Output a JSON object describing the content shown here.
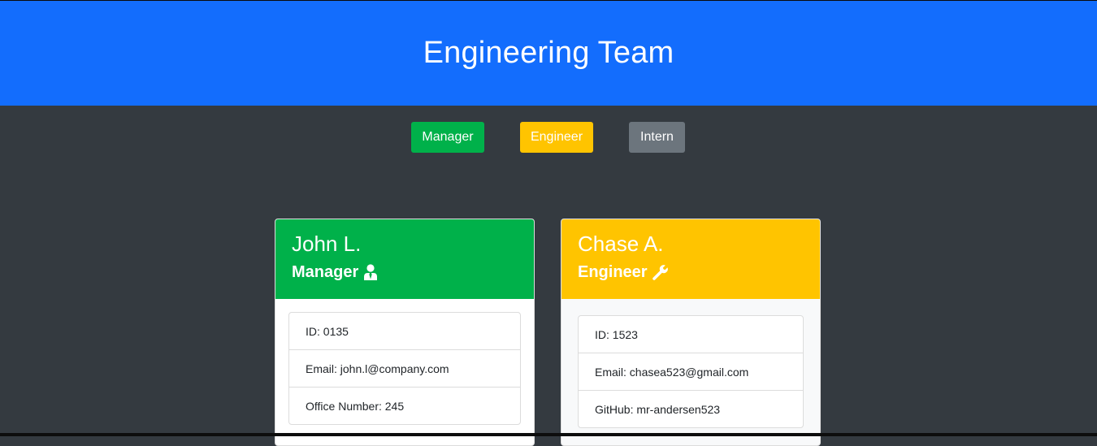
{
  "header": {
    "title": "Engineering Team"
  },
  "buttons": {
    "manager": "Manager",
    "engineer": "Engineer",
    "intern": "Intern"
  },
  "colors": {
    "header": "#136dfd",
    "background": "#343a40",
    "manager": "#00b14a",
    "engineer": "#ffc400",
    "intern": "#6c757d"
  },
  "cards": [
    {
      "name": "John L.",
      "role": "Manager",
      "icon": "user-tie-icon",
      "items": [
        "ID: 0135",
        "Email: john.l@company.com",
        "Office Number: 245"
      ]
    },
    {
      "name": "Chase A.",
      "role": "Engineer",
      "icon": "wrench-icon",
      "items": [
        "ID: 1523",
        "Email: chasea523@gmail.com",
        "GitHub: mr-andersen523"
      ]
    }
  ]
}
